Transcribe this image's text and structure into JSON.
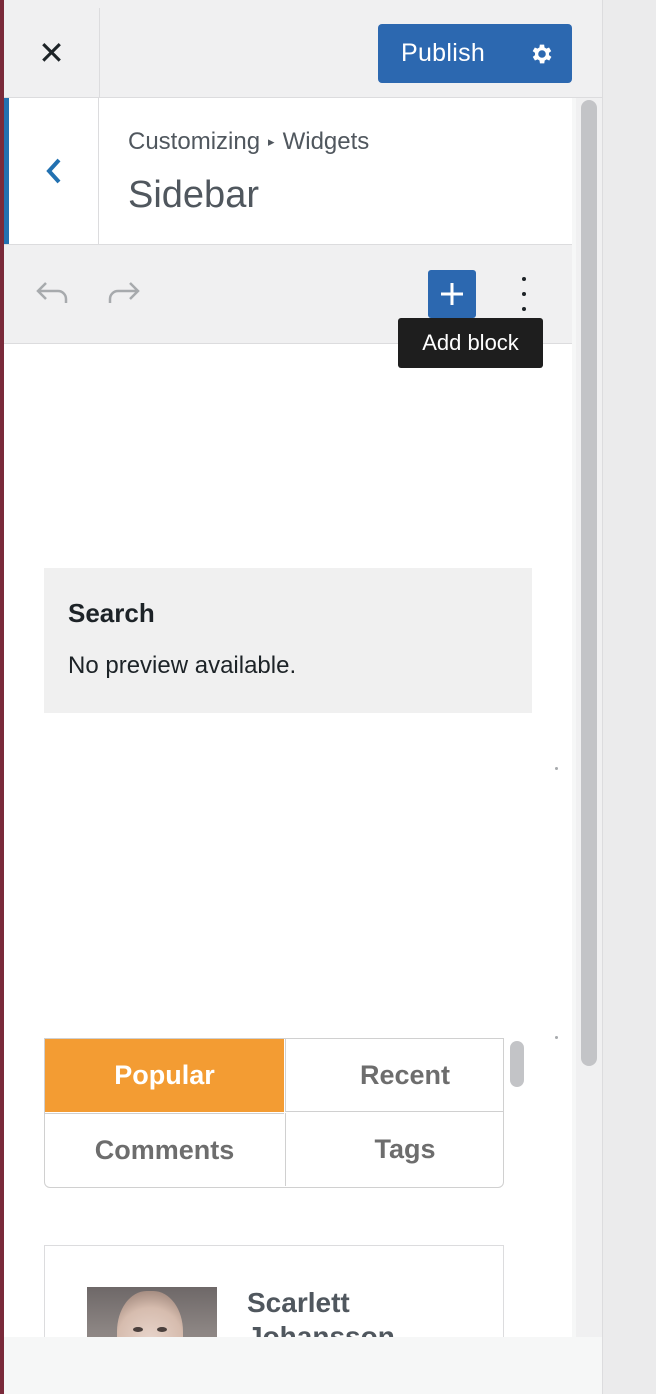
{
  "header": {
    "close_label": "✕",
    "publish_label": "Publish",
    "settings_icon": "gear-icon"
  },
  "section": {
    "breadcrumb_root": "Customizing",
    "breadcrumb_sep": "▸",
    "breadcrumb_current": "Widgets",
    "title": "Sidebar"
  },
  "toolbar": {
    "add_tooltip": "Add block"
  },
  "search_widget": {
    "title": "Search",
    "message": "No preview available."
  },
  "tabs": {
    "items": [
      {
        "label": "Popular",
        "active": true
      },
      {
        "label": "Recent",
        "active": false
      },
      {
        "label": "Comments",
        "active": false
      },
      {
        "label": "Tags",
        "active": false
      }
    ]
  },
  "posts": [
    {
      "name": "Scarlett Johansson"
    }
  ],
  "colors": {
    "accent": "#2c68b0",
    "tab_active": "#f39c33"
  }
}
